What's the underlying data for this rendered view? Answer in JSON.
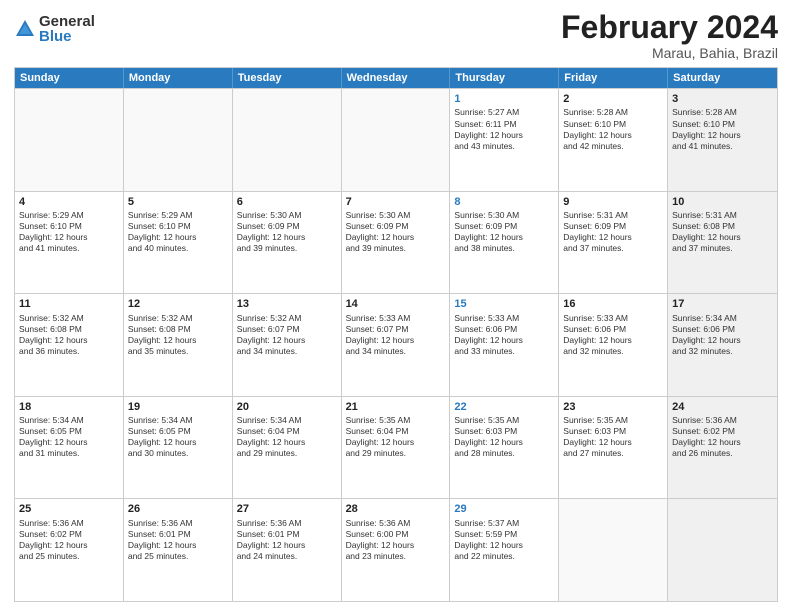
{
  "logo": {
    "general": "General",
    "blue": "Blue"
  },
  "title": {
    "month": "February 2024",
    "location": "Marau, Bahia, Brazil"
  },
  "header_days": [
    "Sunday",
    "Monday",
    "Tuesday",
    "Wednesday",
    "Thursday",
    "Friday",
    "Saturday"
  ],
  "weeks": [
    [
      {
        "day": "",
        "info": "",
        "empty": true
      },
      {
        "day": "",
        "info": "",
        "empty": true
      },
      {
        "day": "",
        "info": "",
        "empty": true
      },
      {
        "day": "",
        "info": "",
        "empty": true
      },
      {
        "day": "1",
        "info": "Sunrise: 5:27 AM\nSunset: 6:11 PM\nDaylight: 12 hours\nand 43 minutes.",
        "thursday": true
      },
      {
        "day": "2",
        "info": "Sunrise: 5:28 AM\nSunset: 6:10 PM\nDaylight: 12 hours\nand 42 minutes."
      },
      {
        "day": "3",
        "info": "Sunrise: 5:28 AM\nSunset: 6:10 PM\nDaylight: 12 hours\nand 41 minutes.",
        "shaded": true
      }
    ],
    [
      {
        "day": "4",
        "info": "Sunrise: 5:29 AM\nSunset: 6:10 PM\nDaylight: 12 hours\nand 41 minutes."
      },
      {
        "day": "5",
        "info": "Sunrise: 5:29 AM\nSunset: 6:10 PM\nDaylight: 12 hours\nand 40 minutes."
      },
      {
        "day": "6",
        "info": "Sunrise: 5:30 AM\nSunset: 6:09 PM\nDaylight: 12 hours\nand 39 minutes."
      },
      {
        "day": "7",
        "info": "Sunrise: 5:30 AM\nSunset: 6:09 PM\nDaylight: 12 hours\nand 39 minutes."
      },
      {
        "day": "8",
        "info": "Sunrise: 5:30 AM\nSunset: 6:09 PM\nDaylight: 12 hours\nand 38 minutes.",
        "thursday": true
      },
      {
        "day": "9",
        "info": "Sunrise: 5:31 AM\nSunset: 6:09 PM\nDaylight: 12 hours\nand 37 minutes."
      },
      {
        "day": "10",
        "info": "Sunrise: 5:31 AM\nSunset: 6:08 PM\nDaylight: 12 hours\nand 37 minutes.",
        "shaded": true
      }
    ],
    [
      {
        "day": "11",
        "info": "Sunrise: 5:32 AM\nSunset: 6:08 PM\nDaylight: 12 hours\nand 36 minutes."
      },
      {
        "day": "12",
        "info": "Sunrise: 5:32 AM\nSunset: 6:08 PM\nDaylight: 12 hours\nand 35 minutes."
      },
      {
        "day": "13",
        "info": "Sunrise: 5:32 AM\nSunset: 6:07 PM\nDaylight: 12 hours\nand 34 minutes."
      },
      {
        "day": "14",
        "info": "Sunrise: 5:33 AM\nSunset: 6:07 PM\nDaylight: 12 hours\nand 34 minutes."
      },
      {
        "day": "15",
        "info": "Sunrise: 5:33 AM\nSunset: 6:06 PM\nDaylight: 12 hours\nand 33 minutes.",
        "thursday": true
      },
      {
        "day": "16",
        "info": "Sunrise: 5:33 AM\nSunset: 6:06 PM\nDaylight: 12 hours\nand 32 minutes."
      },
      {
        "day": "17",
        "info": "Sunrise: 5:34 AM\nSunset: 6:06 PM\nDaylight: 12 hours\nand 32 minutes.",
        "shaded": true
      }
    ],
    [
      {
        "day": "18",
        "info": "Sunrise: 5:34 AM\nSunset: 6:05 PM\nDaylight: 12 hours\nand 31 minutes."
      },
      {
        "day": "19",
        "info": "Sunrise: 5:34 AM\nSunset: 6:05 PM\nDaylight: 12 hours\nand 30 minutes."
      },
      {
        "day": "20",
        "info": "Sunrise: 5:34 AM\nSunset: 6:04 PM\nDaylight: 12 hours\nand 29 minutes."
      },
      {
        "day": "21",
        "info": "Sunrise: 5:35 AM\nSunset: 6:04 PM\nDaylight: 12 hours\nand 29 minutes."
      },
      {
        "day": "22",
        "info": "Sunrise: 5:35 AM\nSunset: 6:03 PM\nDaylight: 12 hours\nand 28 minutes.",
        "thursday": true
      },
      {
        "day": "23",
        "info": "Sunrise: 5:35 AM\nSunset: 6:03 PM\nDaylight: 12 hours\nand 27 minutes."
      },
      {
        "day": "24",
        "info": "Sunrise: 5:36 AM\nSunset: 6:02 PM\nDaylight: 12 hours\nand 26 minutes.",
        "shaded": true
      }
    ],
    [
      {
        "day": "25",
        "info": "Sunrise: 5:36 AM\nSunset: 6:02 PM\nDaylight: 12 hours\nand 25 minutes."
      },
      {
        "day": "26",
        "info": "Sunrise: 5:36 AM\nSunset: 6:01 PM\nDaylight: 12 hours\nand 25 minutes."
      },
      {
        "day": "27",
        "info": "Sunrise: 5:36 AM\nSunset: 6:01 PM\nDaylight: 12 hours\nand 24 minutes."
      },
      {
        "day": "28",
        "info": "Sunrise: 5:36 AM\nSunset: 6:00 PM\nDaylight: 12 hours\nand 23 minutes."
      },
      {
        "day": "29",
        "info": "Sunrise: 5:37 AM\nSunset: 5:59 PM\nDaylight: 12 hours\nand 22 minutes.",
        "thursday": true
      },
      {
        "day": "",
        "info": "",
        "empty": true
      },
      {
        "day": "",
        "info": "",
        "empty": true,
        "shaded": true
      }
    ]
  ]
}
